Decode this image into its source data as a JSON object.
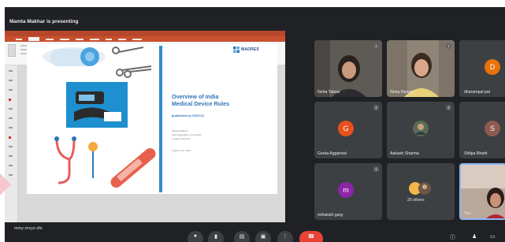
{
  "presenter_banner": "Mamta Makhar is presenting",
  "meeting_code": "mmy-mxyz-xfe",
  "colors": {
    "meet_background": "#202124",
    "tile_background": "#3c4043",
    "ppt_accent": "#b7472a",
    "slide_blue": "#2e75b6",
    "end_call_red": "#ea4335"
  },
  "slide": {
    "title_lines": [
      "Overview of India",
      "Medical Device Rules"
    ],
    "subtitle": "(published by CDSCO)",
    "presenter_info": [
      "Mamta Makhar",
      "Chief Regulatory Consultant",
      "Cnudge Solutions"
    ],
    "date": "August 17th, 2021",
    "logo_text": "MADRES"
  },
  "participants": [
    {
      "name": "Neha Talwar",
      "type": "video"
    },
    {
      "name": "Neha Nangia",
      "type": "video"
    },
    {
      "name": "dharampal pal",
      "type": "avatar",
      "initial": "D",
      "color": "#e8710a"
    },
    {
      "name": "Geeta Aggarwal",
      "type": "avatar",
      "initial": "G",
      "color": "#e8501c"
    },
    {
      "name": "Aakash Sharma",
      "type": "photo"
    },
    {
      "name": "Shilpa Bharti",
      "type": "avatar",
      "initial": "S",
      "color": "#8d5a4f"
    },
    {
      "name": "mihakshi garg",
      "type": "avatar",
      "initial": "m",
      "color": "#8e24aa"
    },
    {
      "name": "20 others",
      "type": "group"
    },
    {
      "name": "You",
      "type": "video"
    }
  ],
  "controls": [
    "mic-icon",
    "camera-icon",
    "captions-icon",
    "present-icon",
    "more-icon",
    "end-call-icon",
    "info-icon",
    "people-icon",
    "chat-icon"
  ]
}
